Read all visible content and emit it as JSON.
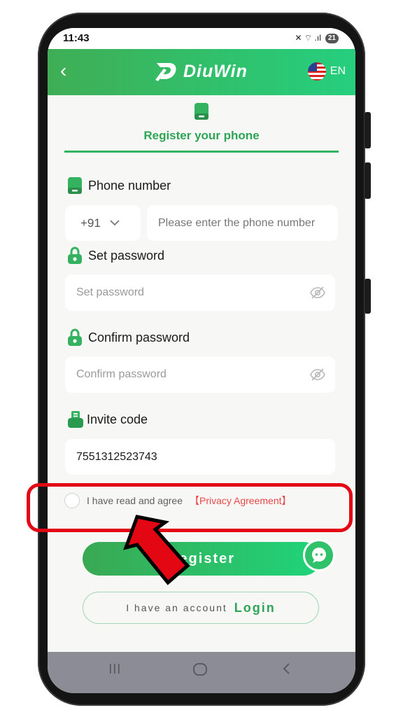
{
  "status_bar": {
    "time": "11:43",
    "signal_icons": "✕ ⌔ .ıl",
    "battery": "21"
  },
  "header": {
    "brand": "DiuWin",
    "language": "EN"
  },
  "tab": {
    "label": "Register your phone"
  },
  "form": {
    "phone_label": "Phone number",
    "country_code": "+91",
    "phone_placeholder": "Please enter the phone number",
    "password_label": "Set password",
    "password_placeholder": "Set password",
    "confirm_label": "Confirm password",
    "confirm_placeholder": "Confirm password",
    "invite_label": "Invite code",
    "invite_value": "7551312523743"
  },
  "agreement": {
    "text": "I have read and agree",
    "link": "【Privacy Agreement】"
  },
  "actions": {
    "register": "Register",
    "account_text": "I have an account",
    "login": "Login"
  },
  "colors": {
    "accent": "#2ea556",
    "header_gradient_start": "#3fae55",
    "header_gradient_end": "#25cf7e",
    "highlight": "#e30613",
    "link_red": "#e84848"
  },
  "icons": [
    "back-arrow",
    "us-flag",
    "phone-device",
    "lock",
    "eye-off",
    "gift-card",
    "chat-bubble",
    "chevron-down"
  ]
}
